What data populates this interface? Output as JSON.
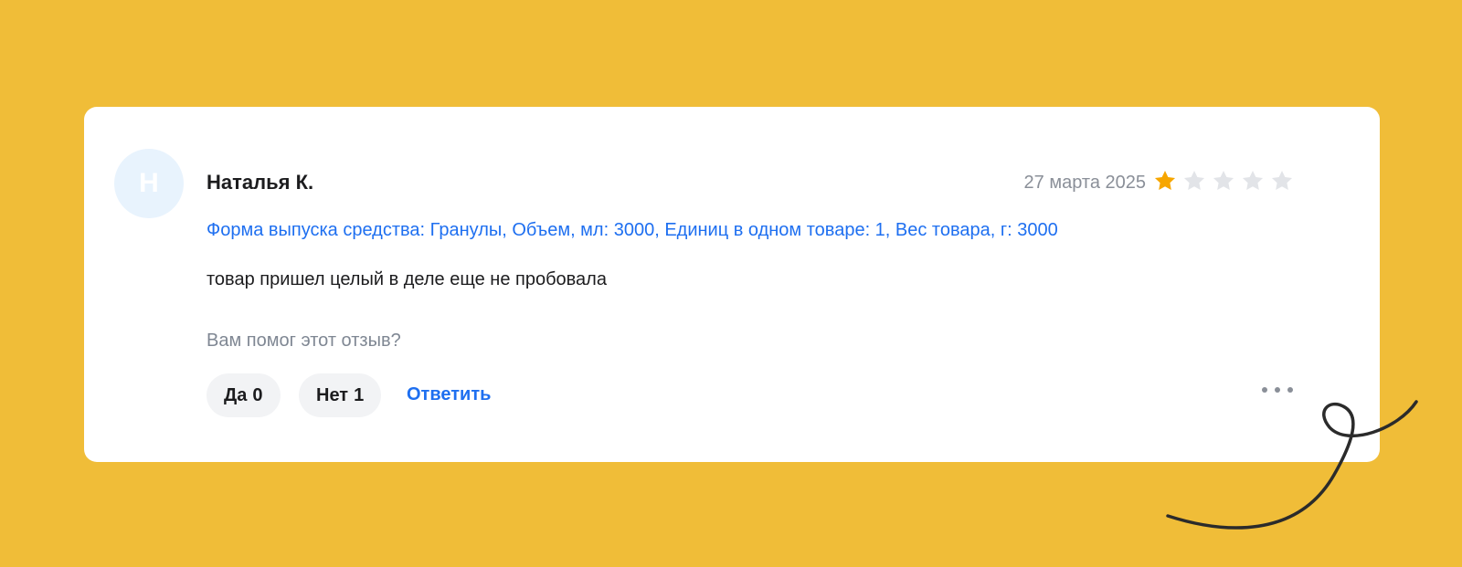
{
  "review": {
    "avatar_letter": "Н",
    "author": "Наталья К.",
    "date": "27 марта 2025",
    "rating": 1,
    "rating_max": 5,
    "variant": "Форма выпуска средства: Гранулы, Объем, мл: 3000, Единиц в одном товаре: 1, Вес товара, г: 3000",
    "text": "товар пришел целый в деле еще не пробовала",
    "helpful_question": "Вам помог этот отзыв?",
    "yes_label": "Да",
    "yes_count": "0",
    "no_label": "Нет",
    "no_count": "1",
    "reply_label": "Ответить",
    "more_icon": "more-dots-icon"
  },
  "colors": {
    "background": "#f0bd38",
    "star_filled": "#f7a600",
    "star_empty": "#e2e4e8",
    "link": "#1e6ff0"
  }
}
